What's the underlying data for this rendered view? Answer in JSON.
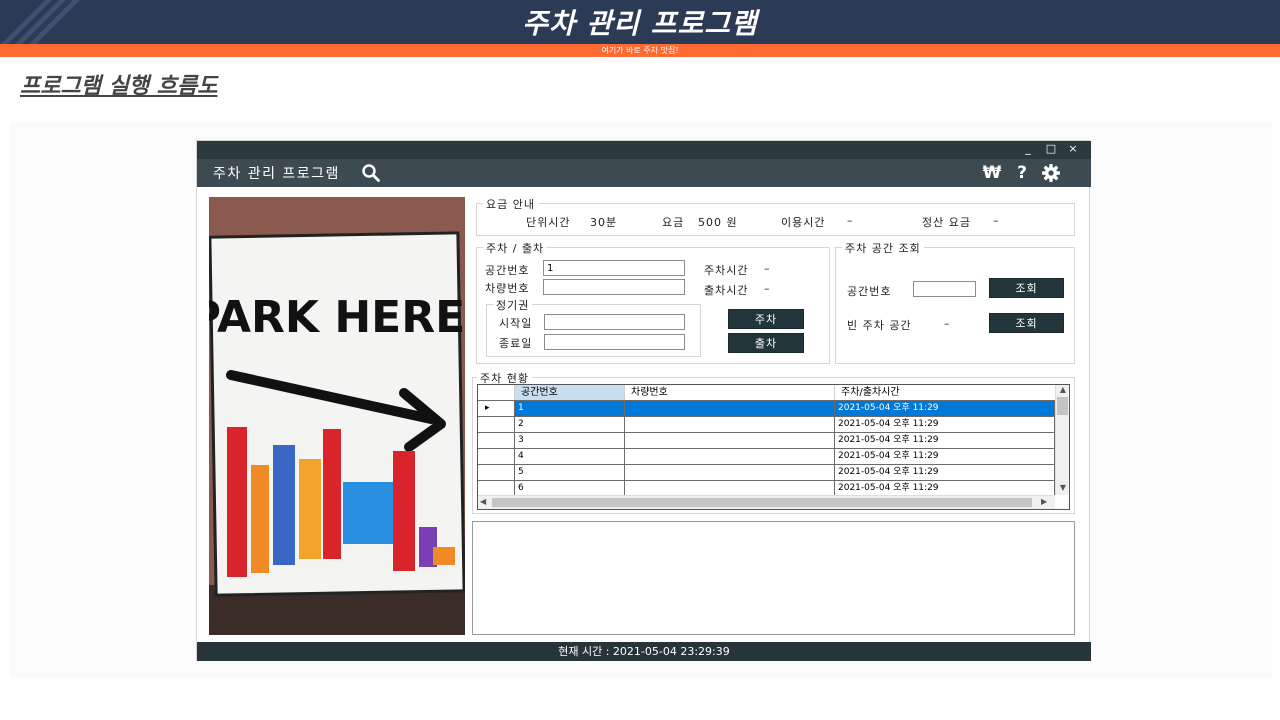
{
  "slide": {
    "title": "주차 관리 프로그램",
    "subtitle": "여기가 바로 주차 맛집!",
    "section_heading": "프로그램 실행 흐름도"
  },
  "window_controls": {
    "minimize": "_",
    "maximize": "□",
    "close": "×"
  },
  "app": {
    "title": "주차 관리 프로그램",
    "header_icons": [
      "search-icon",
      "won-icon",
      "help-icon",
      "gear-icon"
    ],
    "won_symbol": "₩",
    "help_symbol": "?",
    "poster_text": "PARK HERE!"
  },
  "fee_info": {
    "legend": "요금 안내",
    "unit_time_label": "단위시간",
    "unit_time_value": "30분",
    "fee_label": "요금",
    "fee_value": "500 원",
    "usage_time_label": "이용시간",
    "usage_time_value": "–",
    "settlement_label": "정산 요금",
    "settlement_value": "–"
  },
  "parking": {
    "legend": "주차 / 출차",
    "space_no_label": "공간번호",
    "space_no_value": "1",
    "car_no_label": "차량번호",
    "car_no_value": "",
    "park_time_label": "주차시간",
    "park_time_value": "–",
    "exit_time_label": "출차시간",
    "exit_time_value": "–",
    "pass_legend": "정기권",
    "start_label": "시작일",
    "end_label": "종료일",
    "park_button": "주차",
    "exit_button": "출차"
  },
  "lookup": {
    "legend": "주차 공간 조회",
    "space_no_label": "공간번호",
    "empty_label": "빈 주차 공간",
    "empty_value": "–",
    "query_button": "조회",
    "query_button2": "조회"
  },
  "status": {
    "legend": "주차 현황",
    "columns": [
      "공간번호",
      "차량번호",
      "주차/출차시간"
    ],
    "rows": [
      {
        "space": "1",
        "car": "",
        "time": "2021-05-04 오후 11:29"
      },
      {
        "space": "2",
        "car": "",
        "time": "2021-05-04 오후 11:29"
      },
      {
        "space": "3",
        "car": "",
        "time": "2021-05-04 오후 11:29"
      },
      {
        "space": "4",
        "car": "",
        "time": "2021-05-04 오후 11:29"
      },
      {
        "space": "5",
        "car": "",
        "time": "2021-05-04 오후 11:29"
      },
      {
        "space": "6",
        "car": "",
        "time": "2021-05-04 오후 11:29"
      }
    ],
    "selected_row_index": 0
  },
  "footer": {
    "current_time": "현재 시간 : 2021-05-04 23:29:39"
  },
  "colors": {
    "header_bg": "#2b3b55",
    "accent": "#ff6a32",
    "selection": "#0078d7",
    "button": "#22353b"
  }
}
